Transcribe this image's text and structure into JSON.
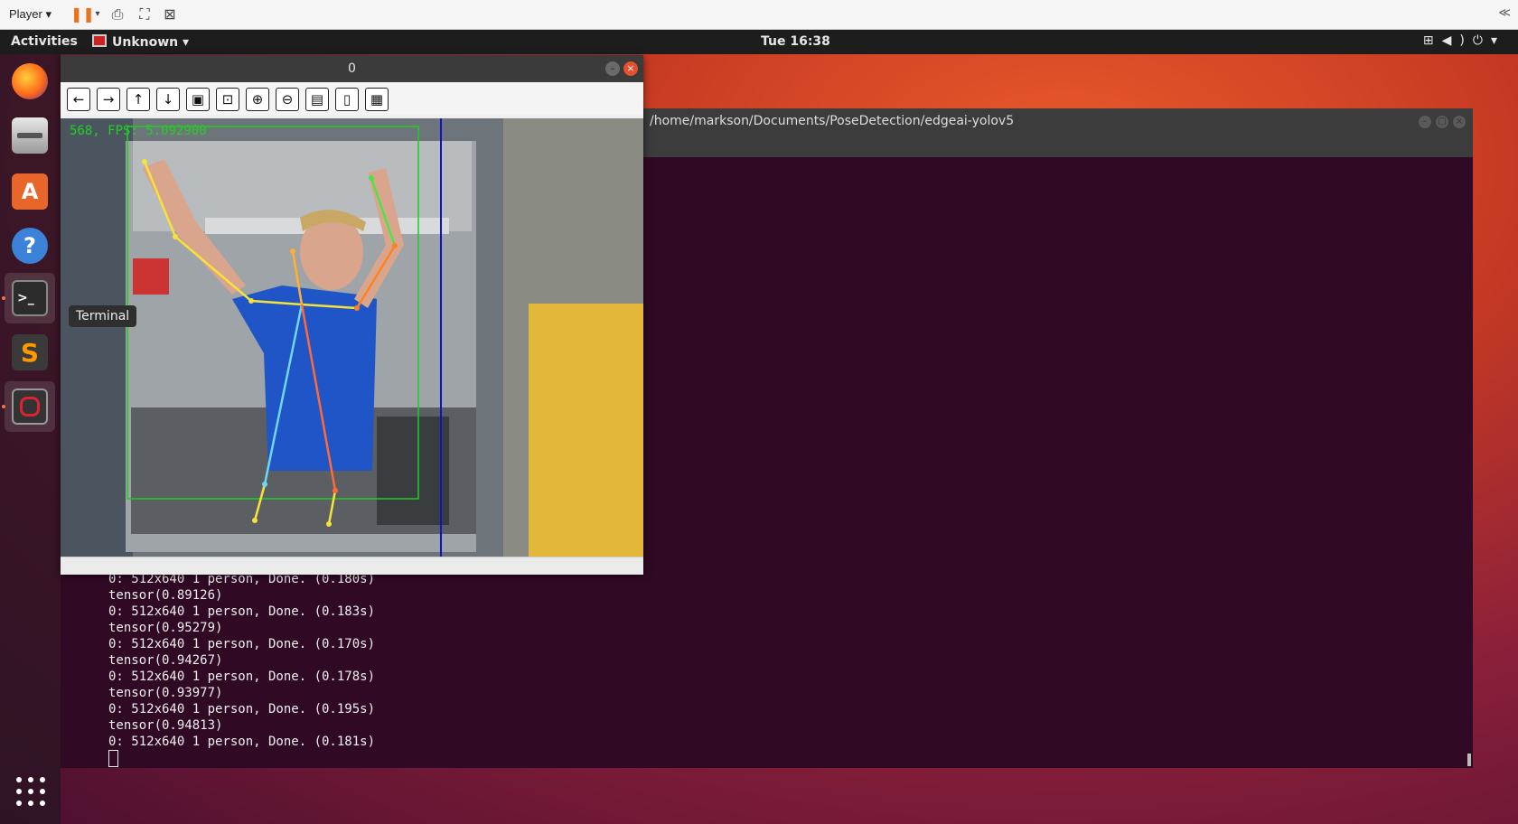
{
  "player": {
    "menu_label": "Player ▾",
    "collapse_label": "≪"
  },
  "topbar": {
    "activities": "Activities",
    "app_name": "Unknown ▾",
    "clock": "Tue 16:38"
  },
  "dock": {
    "tooltip": "Terminal",
    "items": [
      "firefox-icon",
      "files-icon",
      "software-icon",
      "help-icon",
      "terminal-icon",
      "sublime-icon",
      "recorder-icon"
    ]
  },
  "terminal": {
    "title": "/home/markson/Documents/PoseDetection/edgeai-yolov5",
    "lines": [
      "0: 512x640 1 person, Done. (0.180s)",
      "tensor(0.89126)",
      "0: 512x640 1 person, Done. (0.183s)",
      "tensor(0.95279)",
      "0: 512x640 1 person, Done. (0.170s)",
      "tensor(0.94267)",
      "0: 512x640 1 person, Done. (0.178s)",
      "tensor(0.93977)",
      "0: 512x640 1 person, Done. (0.195s)",
      "tensor(0.94813)",
      "0: 512x640 1 person, Done. (0.181s)"
    ]
  },
  "cv_window": {
    "title": "0",
    "fps_label": "568, FPS: 5.092900",
    "toolbar": [
      "pan-left",
      "pan-right",
      "pan-up",
      "pan-down",
      "zoom-fit",
      "zoom-original",
      "zoom-in",
      "zoom-out",
      "save-image",
      "copy-clipboard",
      "properties"
    ],
    "keypoint_color_left": "#f7e23a",
    "keypoint_color_right": "#ff7f27",
    "bbox_color": "#22cc22",
    "line_color": "#1111cc"
  }
}
